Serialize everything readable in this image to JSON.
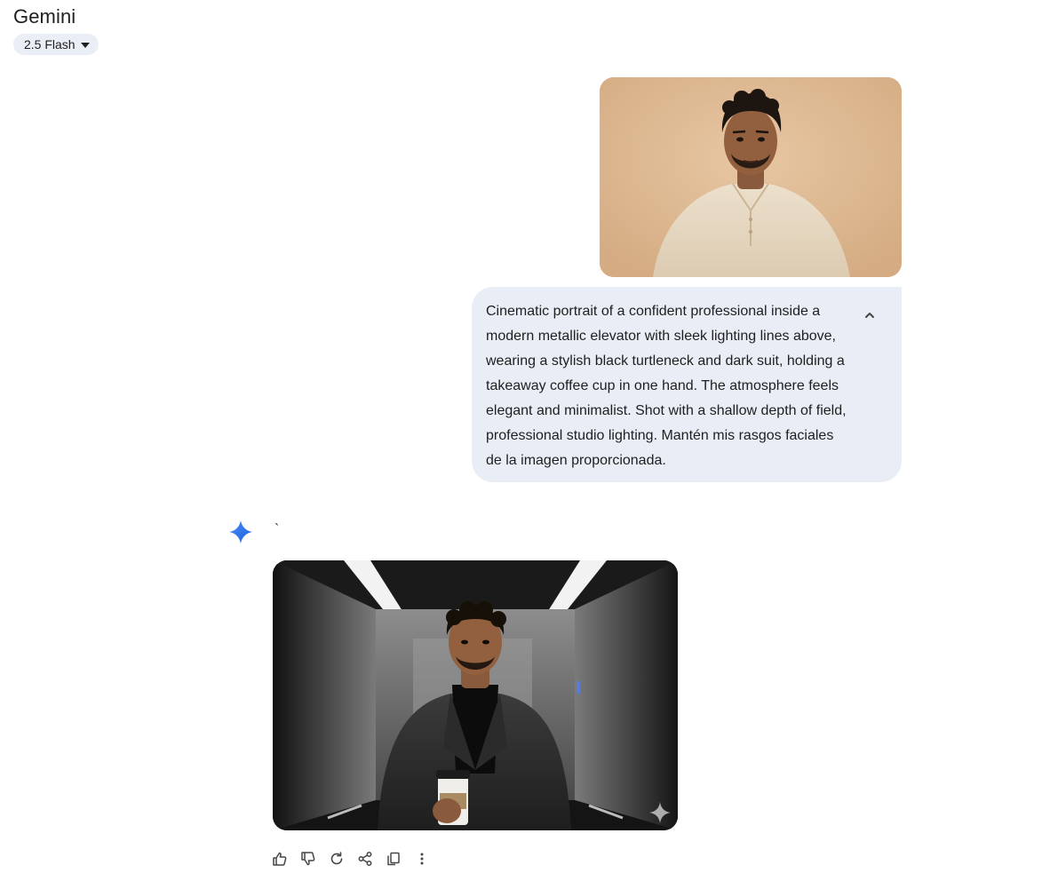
{
  "app": {
    "title": "Gemini",
    "model_label": "2.5 Flash"
  },
  "user_message": {
    "image_alt": "Portrait of a man with curly hair in a beige henley shirt against a tan wall",
    "prompt": "Cinematic portrait of a confident professional inside a modern metallic elevator with sleek lighting lines above, wearing a stylish black turtleneck and dark suit, holding a takeaway coffee cup in one hand. The atmosphere feels elegant and minimalist. Shot with a shallow depth of field, professional studio lighting. Mantén mis rasgos faciales de la imagen proporcionada."
  },
  "response": {
    "text": "`",
    "image_alt": "Man in black turtleneck and dark suit holding a coffee cup inside a metallic elevator"
  },
  "colors": {
    "accent": "#1a73e8",
    "bubble": "#e9eef6",
    "pill": "#eaeef6",
    "icon": "#444746"
  },
  "icons": {
    "collapse": "chevron-up-icon",
    "actions": [
      "thumb-up-icon",
      "thumb-down-icon",
      "regenerate-icon",
      "share-icon",
      "copy-icon",
      "more-vert-icon"
    ]
  }
}
